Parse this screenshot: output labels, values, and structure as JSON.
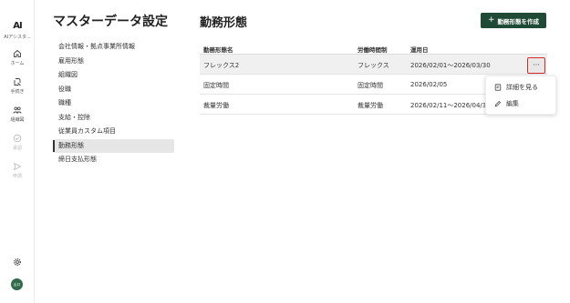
{
  "brand": {
    "logo": "AI",
    "name": "AIアシスタ..."
  },
  "rail": {
    "items": [
      {
        "label": "ホーム",
        "icon": "home-icon",
        "disabled": false
      },
      {
        "label": "手続き",
        "icon": "document-icon",
        "disabled": false
      },
      {
        "label": "組織図",
        "icon": "people-icon",
        "disabled": false
      },
      {
        "label": "承認",
        "icon": "check-circle-icon",
        "disabled": true
      },
      {
        "label": "申請",
        "icon": "send-icon",
        "disabled": true
      }
    ],
    "settings_icon": "gear-icon",
    "avatar": "山口"
  },
  "settings": {
    "title": "マスターデータ設定",
    "nav": [
      "会社情報・拠点事業所情報",
      "雇用形態",
      "組織図",
      "役職",
      "職種",
      "支給・控除",
      "従業員カスタム項目",
      "勤務形態",
      "締日支払形態"
    ],
    "active_index": 7
  },
  "main": {
    "title": "勤務形態",
    "create_button": "勤務形態を作成",
    "columns": [
      "勤務形態名",
      "労働時間制",
      "運用日"
    ],
    "rows": [
      {
        "name": "フレックス2",
        "system": "フレックス",
        "period": "2026/02/01〜2026/03/30"
      },
      {
        "name": "固定時間",
        "system": "固定時間",
        "period": "2026/02/05"
      },
      {
        "name": "裁量労働",
        "system": "裁量労働",
        "period": "2026/02/11〜2026/04/30"
      }
    ],
    "more_button": "···"
  },
  "context_menu": {
    "items": [
      {
        "label": "詳細を見る",
        "icon": "document-view-icon"
      },
      {
        "label": "編集",
        "icon": "pencil-icon"
      }
    ]
  },
  "colors": {
    "primary": "#1f4a35",
    "highlight": "#d42b2b",
    "active_bg": "#e6e6e6"
  }
}
